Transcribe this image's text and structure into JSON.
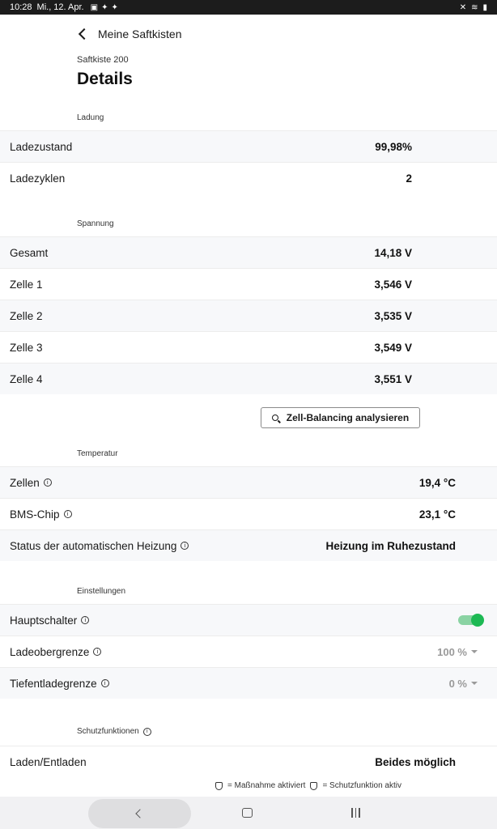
{
  "status_bar": {
    "time": "10:28",
    "date": "Mi., 12. Apr.",
    "left_icons": [
      "gallery-icon",
      "twitter-icon",
      "twitter-icon"
    ],
    "right_icons": [
      "mute-icon",
      "wifi-icon",
      "battery-icon"
    ]
  },
  "header": {
    "back_label": "Meine Saftkisten",
    "subtitle": "Saftkiste 200",
    "title": "Details"
  },
  "sections": {
    "ladung": {
      "label": "Ladung",
      "rows": [
        {
          "label": "Ladezustand",
          "value": "99,98%"
        },
        {
          "label": "Ladezyklen",
          "value": "2"
        }
      ]
    },
    "spannung": {
      "label": "Spannung",
      "rows": [
        {
          "label": "Gesamt",
          "value": "14,18 V"
        },
        {
          "label": "Zelle 1",
          "value": "3,546 V"
        },
        {
          "label": "Zelle 2",
          "value": "3,535 V"
        },
        {
          "label": "Zelle 3",
          "value": "3,549 V"
        },
        {
          "label": "Zelle 4",
          "value": "3,551 V"
        }
      ],
      "button_label": "Zell-Balancing analysieren"
    },
    "temperatur": {
      "label": "Temperatur",
      "rows": [
        {
          "label": "Zellen",
          "value": "19,4 °C"
        },
        {
          "label": "BMS-Chip",
          "value": "23,1 °C"
        },
        {
          "label": "Status der automatischen Heizung",
          "value": "Heizung im Ruhezustand"
        }
      ]
    },
    "einstellungen": {
      "label": "Einstellungen",
      "rows": [
        {
          "label": "Hauptschalter",
          "toggle_on": true
        },
        {
          "label": "Ladeobergrenze",
          "value": "100 %"
        },
        {
          "label": "Tiefentladegrenze",
          "value": "0 %"
        }
      ]
    },
    "schutzfunktionen": {
      "label": "Schutzfunktionen",
      "rows": [
        {
          "label": "Laden/Entladen",
          "value": "Beides möglich"
        }
      ]
    }
  },
  "legend": {
    "measure_text": "= Maßnahme aktiviert",
    "protection_text": "= Schutzfunktion aktiv"
  },
  "colors": {
    "toggle_on": "#1db954",
    "row_shade": "#f7f8fa",
    "status_bar": "#1c1c1c"
  }
}
